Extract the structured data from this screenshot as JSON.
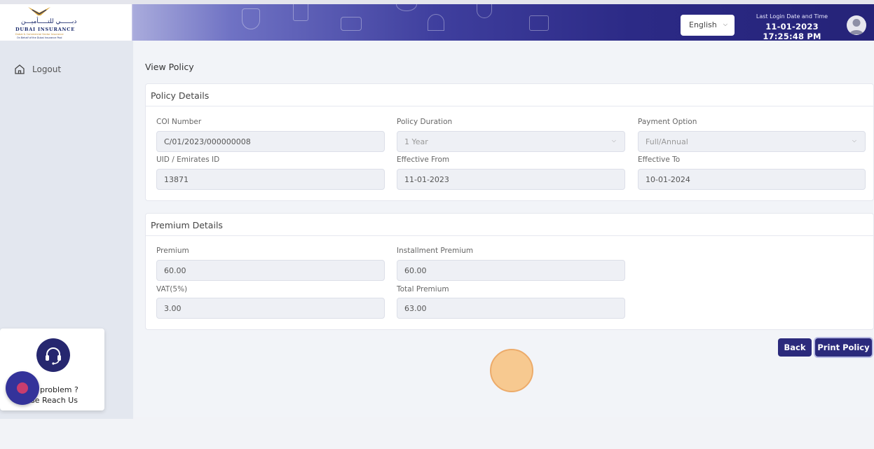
{
  "header": {
    "logo": {
      "arabic": "دبــــــي للتـــــأميـــن",
      "english": "DUBAI INSURANCE",
      "tagline1": "Dubai & Commercial Sector Insurance",
      "tagline2": "On Behalf of the Dubai Insurance Pool"
    },
    "language": "English",
    "last_login_label": "Last Login Date and Time",
    "last_login_value": "11-01-2023 17:25:48 PM"
  },
  "sidebar": {
    "logout_label": "Logout"
  },
  "page": {
    "title": "View Policy"
  },
  "policy_details": {
    "title": "Policy Details",
    "coi_label": "COI Number",
    "coi_value": "C/01/2023/000000008",
    "duration_label": "Policy Duration",
    "duration_value": "1 Year",
    "payment_label": "Payment Option",
    "payment_value": "Full/Annual",
    "uid_label": "UID / Emirates ID",
    "uid_value": "13871",
    "from_label": "Effective From",
    "from_value": "11-01-2023",
    "to_label": "Effective To",
    "to_value": "10-01-2024"
  },
  "premium_details": {
    "title": "Premium Details",
    "premium_label": "Premium",
    "premium_value": "60.00",
    "installment_label": "Installment Premium",
    "installment_value": "60.00",
    "vat_label": "VAT(5%)",
    "vat_value": "3.00",
    "total_label": "Total Premium",
    "total_value": "63.00"
  },
  "actions": {
    "back_label": "Back",
    "print_label": "Print Policy"
  },
  "help": {
    "line1": "ny problem ?",
    "line2": "se Reach Us"
  },
  "colors": {
    "primary": "#2b2a7c",
    "header_gradient_end": "#252378",
    "cursor_highlight": "#f9c27f"
  }
}
